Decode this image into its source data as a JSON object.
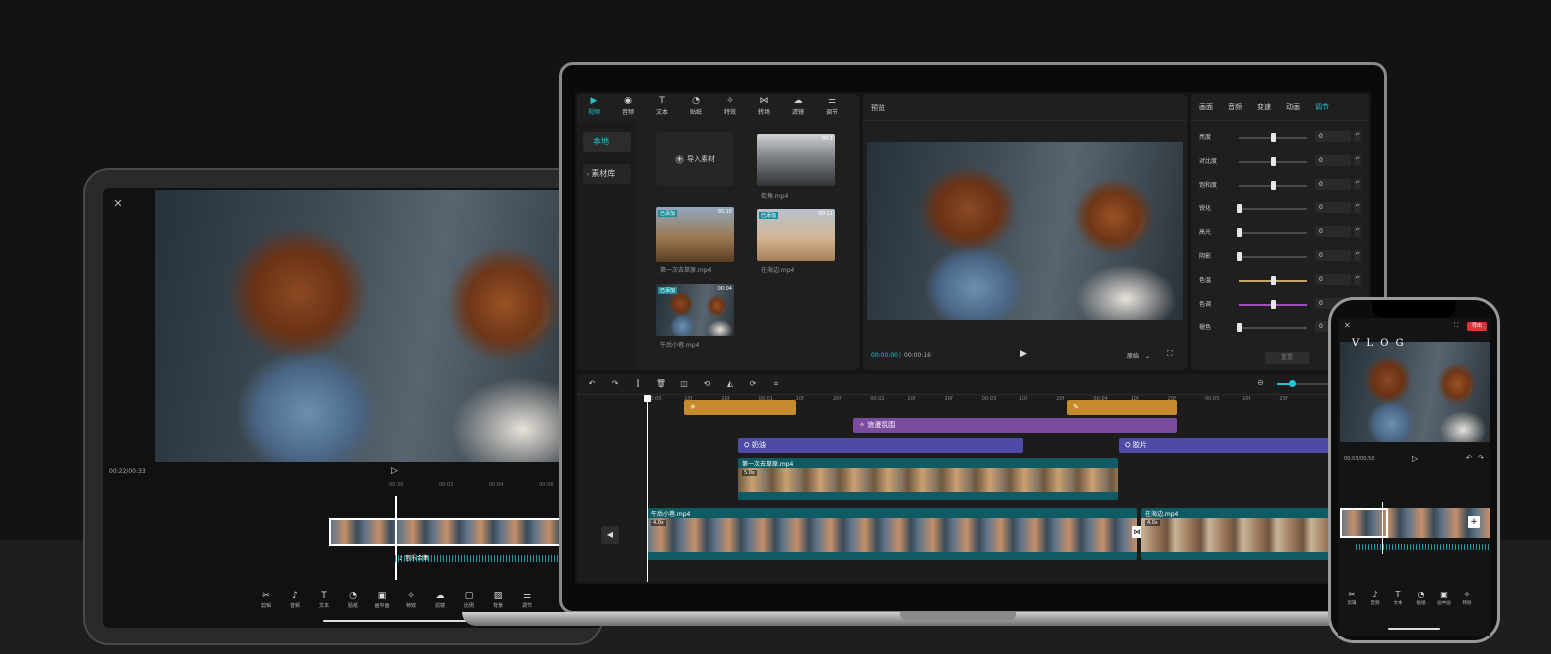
{
  "tablet": {
    "close_icon": "close-icon",
    "timecode": "00:22/00:33",
    "play_icon": "play-icon",
    "ruler_ticks": [
      "00:30",
      "00:02",
      "00:04",
      "00:06"
    ],
    "music_label": "音乐合集",
    "toolbar": [
      {
        "icon": "scissors-icon",
        "label": "剪辑"
      },
      {
        "icon": "music-note-icon",
        "label": "音频"
      },
      {
        "icon": "text-icon",
        "label": "文本"
      },
      {
        "icon": "sticker-icon",
        "label": "贴纸"
      },
      {
        "icon": "pip-icon",
        "label": "画中画"
      },
      {
        "icon": "effects-icon",
        "label": "特效"
      },
      {
        "icon": "filter-icon",
        "label": "滤镜"
      },
      {
        "icon": "ratio-icon",
        "label": "比例"
      },
      {
        "icon": "background-icon",
        "label": "背景"
      },
      {
        "icon": "adjust-icon",
        "label": "调节"
      }
    ]
  },
  "laptop": {
    "media_tabs": [
      {
        "icon": "video-icon",
        "label": "视频",
        "active": true
      },
      {
        "icon": "audio-icon",
        "label": "音频",
        "active": false
      },
      {
        "icon": "text-icon",
        "label": "文本",
        "active": false
      },
      {
        "icon": "sticker-icon",
        "label": "贴纸",
        "active": false
      },
      {
        "icon": "effects-icon",
        "label": "特效",
        "active": false
      },
      {
        "icon": "transition-icon",
        "label": "转场",
        "active": false
      },
      {
        "icon": "filter-icon",
        "label": "滤镜",
        "active": false
      },
      {
        "icon": "adjust-icon",
        "label": "调节",
        "active": false
      }
    ],
    "media_side": [
      "本地",
      "素材库"
    ],
    "import_label": "导入素材",
    "media_items": [
      {
        "name": "街角.mp4",
        "duration": "00:1",
        "tag": "",
        "kind": "street"
      },
      {
        "name": "第一次去草原.mp4",
        "duration": "00:10",
        "tag": "已添加",
        "kind": "horse"
      },
      {
        "name": "在海边.mp4",
        "duration": "00:11",
        "tag": "已添加",
        "kind": "beach"
      },
      {
        "name": "午后小巷.mp4",
        "duration": "00:04",
        "tag": "已添加",
        "kind": "city"
      }
    ],
    "preview": {
      "title": "预览",
      "current_time": "00:00:00",
      "total_time": "00:00:16",
      "ratio_label": "原始",
      "play_icon": "play-icon",
      "fullscreen_icon": "fullscreen-icon"
    },
    "inspector": {
      "tabs": [
        {
          "label": "画面",
          "active": false
        },
        {
          "label": "音频",
          "active": false
        },
        {
          "label": "变速",
          "active": false
        },
        {
          "label": "动画",
          "active": false
        },
        {
          "label": "调节",
          "active": true
        }
      ],
      "sliders": [
        {
          "label": "亮度",
          "value": "0",
          "level": 0.5,
          "color": "#4a4a4a"
        },
        {
          "label": "对比度",
          "value": "0",
          "level": 0.5,
          "color": "#4a4a4a"
        },
        {
          "label": "饱和度",
          "value": "0",
          "level": 0.5,
          "color": "#4a4a4a"
        },
        {
          "label": "锐化",
          "value": "0",
          "level": 0.0,
          "color": "#4a4a4a"
        },
        {
          "label": "高光",
          "value": "0",
          "level": 0.0,
          "color": "#4a4a4a"
        },
        {
          "label": "阴影",
          "value": "0",
          "level": 0.0,
          "color": "#4a4a4a"
        },
        {
          "label": "色温",
          "value": "0",
          "level": 0.5,
          "color": "#c7a36a"
        },
        {
          "label": "色调",
          "value": "0",
          "level": 0.5,
          "color": "#a04fb8"
        },
        {
          "label": "褪色",
          "value": "0",
          "level": 0.0,
          "color": "#4a4a4a"
        }
      ],
      "reset_label": "重置"
    },
    "timeline": {
      "toolbar_icons": [
        "undo-icon",
        "redo-icon",
        "split-icon",
        "delete-icon",
        "freeze-icon",
        "reverse-icon",
        "mirror-icon",
        "rotate-icon",
        "crop-icon"
      ],
      "ruler": [
        "00:00",
        "10f",
        "20f",
        "00:01",
        "10f",
        "20f",
        "00:02",
        "10f",
        "20f",
        "00:03",
        "10f",
        "20f",
        "00:04",
        "10f",
        "20f",
        "00:05",
        "10f",
        "20f"
      ],
      "stickers": [
        "sticker-star-icon",
        "sticker-feather-icon"
      ],
      "effects": {
        "icon": "effects-icon",
        "label": "浪漫氛围"
      },
      "filters": [
        {
          "label": "奶油"
        },
        {
          "label": "胶片"
        }
      ],
      "clip_upper": {
        "name": "第一次去草原.mp4",
        "duration": "5.0s"
      },
      "clip_main_a": {
        "name": "午后小巷.mp4",
        "duration": "4.0s"
      },
      "clip_main_b": {
        "name": "在海边.mp4",
        "duration": "4.0s"
      },
      "mute_icon": "volume-icon"
    },
    "colors": {
      "accent": "#22c3d5",
      "filter_track": "#4f4aa8",
      "effect_track": "#7a4b9e",
      "sticker_track": "#c48a2c",
      "video_track": "#0f5b63"
    }
  },
  "phone": {
    "close_icon": "close-icon",
    "export_label": "导出",
    "vlog_title": "V L O G",
    "timecode": "00:03/00:50",
    "toolbar": [
      {
        "icon": "scissors-icon",
        "label": "剪辑"
      },
      {
        "icon": "music-note-icon",
        "label": "音频"
      },
      {
        "icon": "text-icon",
        "label": "文本"
      },
      {
        "icon": "sticker-icon",
        "label": "贴纸"
      },
      {
        "icon": "pip-icon",
        "label": "画中画"
      },
      {
        "icon": "effects-icon",
        "label": "特效"
      }
    ]
  }
}
